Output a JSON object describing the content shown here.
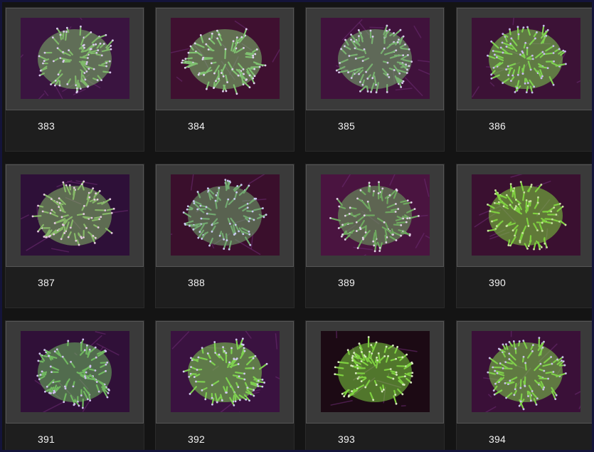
{
  "gallery": {
    "items": [
      {
        "label": "383",
        "coral": "#7fb86a",
        "tips": "#d9c8ee",
        "bg": "#3a1440"
      },
      {
        "label": "384",
        "coral": "#7fc070",
        "tips": "#e0d0f0",
        "bg": "#3f1030"
      },
      {
        "label": "385",
        "coral": "#78b070",
        "tips": "#d6c8ec",
        "bg": "#40123c"
      },
      {
        "label": "386",
        "coral": "#7ed050",
        "tips": "#c8b8f0",
        "bg": "#3c1236"
      },
      {
        "label": "387",
        "coral": "#86b868",
        "tips": "#e4c8e0",
        "bg": "#2e1038"
      },
      {
        "label": "388",
        "coral": "#72a870",
        "tips": "#c8c8f0",
        "bg": "#3a0f2c"
      },
      {
        "label": "389",
        "coral": "#6fa860",
        "tips": "#e2d0e8",
        "bg": "#4a1440"
      },
      {
        "label": "390",
        "coral": "#7fd040",
        "tips": "#c8e0a0",
        "bg": "#3a1030"
      },
      {
        "label": "391",
        "coral": "#70b860",
        "tips": "#d0c0f0",
        "bg": "#301038"
      },
      {
        "label": "392",
        "coral": "#7ed050",
        "tips": "#d0c8f0",
        "bg": "#3a1240"
      },
      {
        "label": "393",
        "coral": "#7ed040",
        "tips": "#d8e8c0",
        "bg": "#1c0a14"
      },
      {
        "label": "394",
        "coral": "#7fcf4a",
        "tips": "#c8c0e8",
        "bg": "#3a1038"
      }
    ]
  }
}
